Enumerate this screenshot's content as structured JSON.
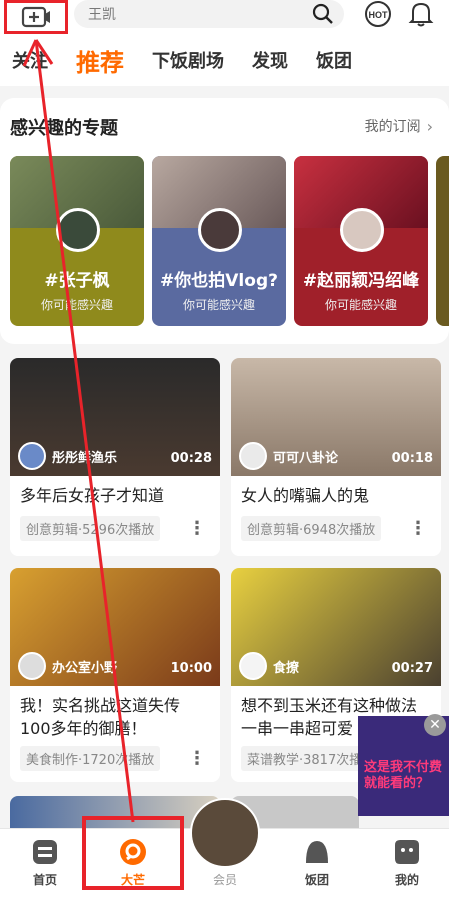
{
  "header": {
    "search_text": "王凯",
    "hot_label": "HOT"
  },
  "tabs": [
    {
      "label": "关注"
    },
    {
      "label": "推荐"
    },
    {
      "label": "下饭剧场"
    },
    {
      "label": "发现"
    },
    {
      "label": "饭团"
    }
  ],
  "interest": {
    "title": "感兴趣的专题",
    "more": "我的订阅",
    "cards": [
      {
        "tag": "#张子枫",
        "sub": "你可能感兴趣",
        "bg": "#8f8a1c"
      },
      {
        "tag": "#你也拍Vlog?",
        "sub": "你可能感兴趣",
        "bg": "#5a6aa0"
      },
      {
        "tag": "#赵丽颖冯绍峰",
        "sub": "你可能感兴趣",
        "bg": "#a0202a"
      }
    ]
  },
  "videos": [
    {
      "author": "彤彤鲜渔乐",
      "duration": "00:28",
      "title": "多年后女孩子才知道",
      "meta": "创意剪辑·5296次播放"
    },
    {
      "author": "可可八卦论",
      "duration": "00:18",
      "title": "女人的嘴骗人的鬼",
      "meta": "创意剪辑·6948次播放"
    },
    {
      "author": "办公室小野",
      "duration": "10:00",
      "title": "我！实名挑战这道失传100多年的御膳！",
      "meta": "美食制作·1720次播放"
    },
    {
      "author": "食撩",
      "duration": "00:27",
      "title": "想不到玉米还有这种做法 一串一串超可爱",
      "meta": "菜谱教学·3817次播放"
    }
  ],
  "ad": {
    "text": "这是我不付费就能看的？",
    "close": "✕"
  },
  "bottom_nav": [
    {
      "label": "首页"
    },
    {
      "label": "大芒"
    },
    {
      "label": "会员"
    },
    {
      "label": "饭团"
    },
    {
      "label": "我的"
    }
  ],
  "colors": {
    "accent": "#ff6a00",
    "annotation": "#e8232a"
  }
}
